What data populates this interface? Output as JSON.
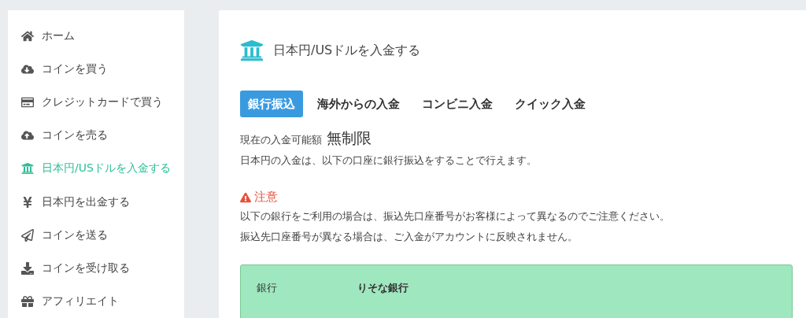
{
  "sidebar": {
    "items": [
      {
        "label": "ホーム",
        "selected": false
      },
      {
        "label": "コインを買う",
        "selected": false
      },
      {
        "label": "クレジットカードで買う",
        "selected": false
      },
      {
        "label": "コインを売る",
        "selected": false
      },
      {
        "label": "日本円/USドルを入金する",
        "selected": true
      },
      {
        "label": "日本円を出金する",
        "selected": false
      },
      {
        "label": "コインを送る",
        "selected": false
      },
      {
        "label": "コインを受け取る",
        "selected": false
      },
      {
        "label": "アフィリエイト",
        "selected": false
      }
    ]
  },
  "main": {
    "title": "日本円/USドルを入金する",
    "tabs": [
      {
        "label": "銀行振込",
        "selected": true
      },
      {
        "label": "海外からの入金",
        "selected": false
      },
      {
        "label": "コンビニ入金",
        "selected": false
      },
      {
        "label": "クイック入金",
        "selected": false
      }
    ],
    "limit": {
      "label": "現在の入金可能額",
      "value": "無制限"
    },
    "description": "日本円の入金は、以下の口座に銀行振込をすることで行えます。",
    "notice": {
      "title": "注意",
      "lines": [
        "以下の銀行をご利用の場合は、振込先口座番号がお客様によって異なるのでご注意ください。",
        "振込先口座番号が異なる場合は、ご入金がアカウントに反映されません。"
      ]
    },
    "account": [
      {
        "label": "銀行",
        "value": "りそな銀行"
      }
    ]
  }
}
